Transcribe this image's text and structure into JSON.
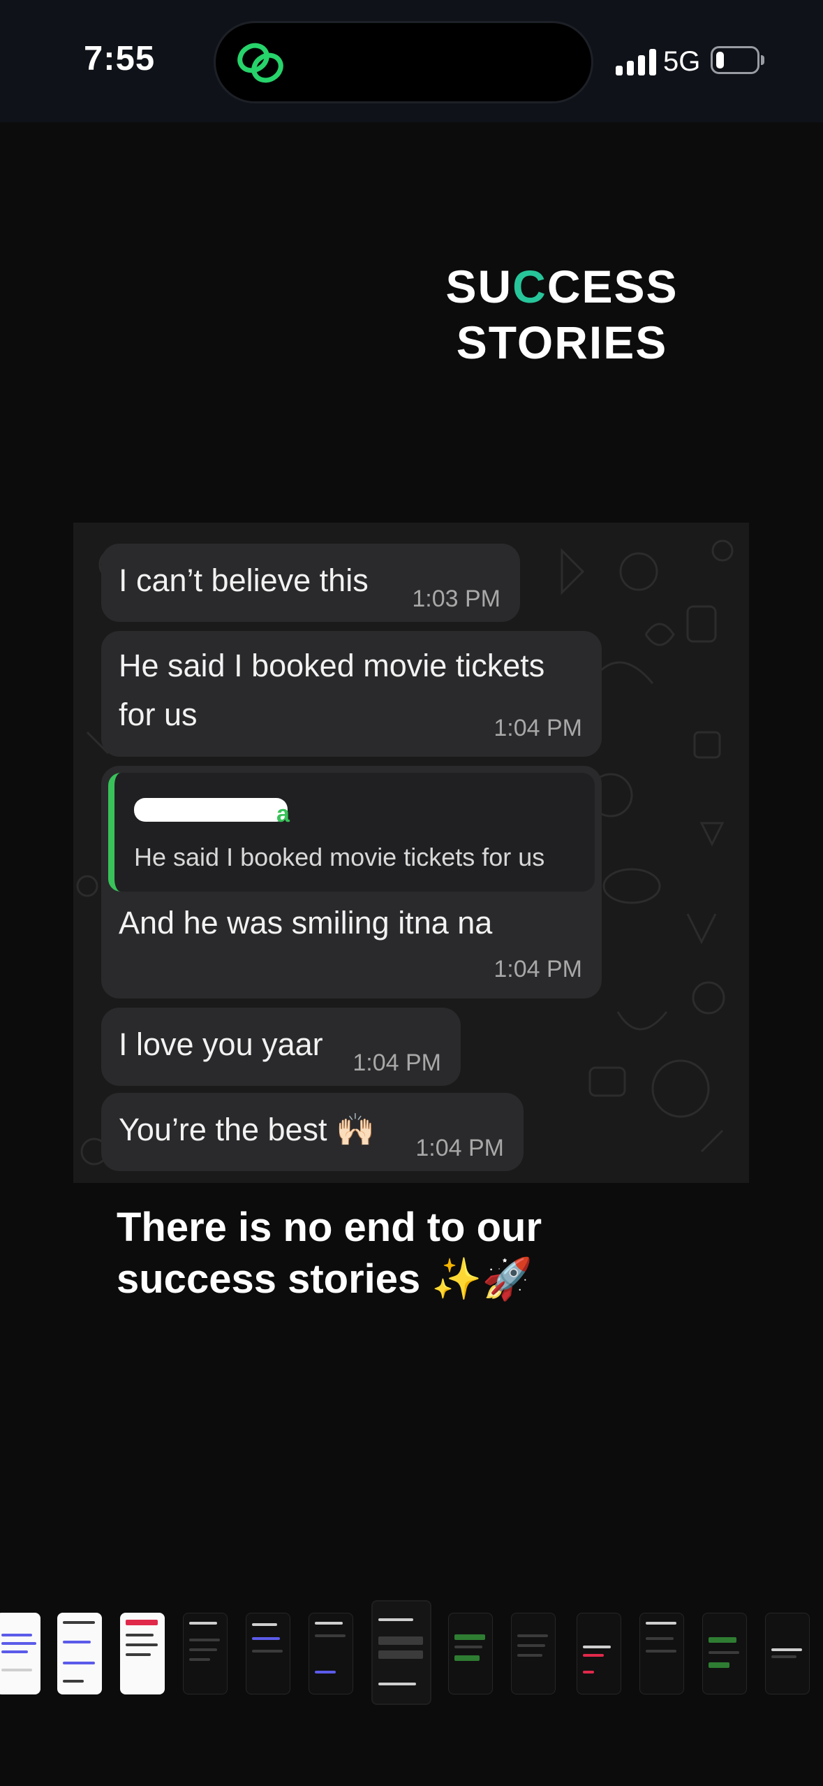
{
  "status_bar": {
    "time": "7:55",
    "network": "5G",
    "app_icon": "link-rings-icon",
    "accent_color": "#27d36b"
  },
  "story": {
    "title_line1": "SUCCESS",
    "title_line2": "STORIES",
    "title_accent_color": "#27c59a",
    "caption_line1": "There is no end to our",
    "caption_line2": "success stories ✨🚀"
  },
  "chat": {
    "messages": [
      {
        "text": "I can’t believe this",
        "time": "1:03 PM"
      },
      {
        "text_line1": "He said I booked movie tickets",
        "text_line2": "for us",
        "time": "1:04 PM"
      },
      {
        "quoted_text": "He said I booked movie tickets for us",
        "text": "And he was smiling itna na",
        "time": "1:04 PM"
      },
      {
        "text": "I love you yaar",
        "time": "1:04 PM"
      },
      {
        "text": "You’re the best 🙌🏻",
        "time": "1:04 PM"
      }
    ],
    "quote_bar_color": "#39c25a"
  },
  "thumbnails": {
    "count": 13,
    "active_index": 6
  }
}
